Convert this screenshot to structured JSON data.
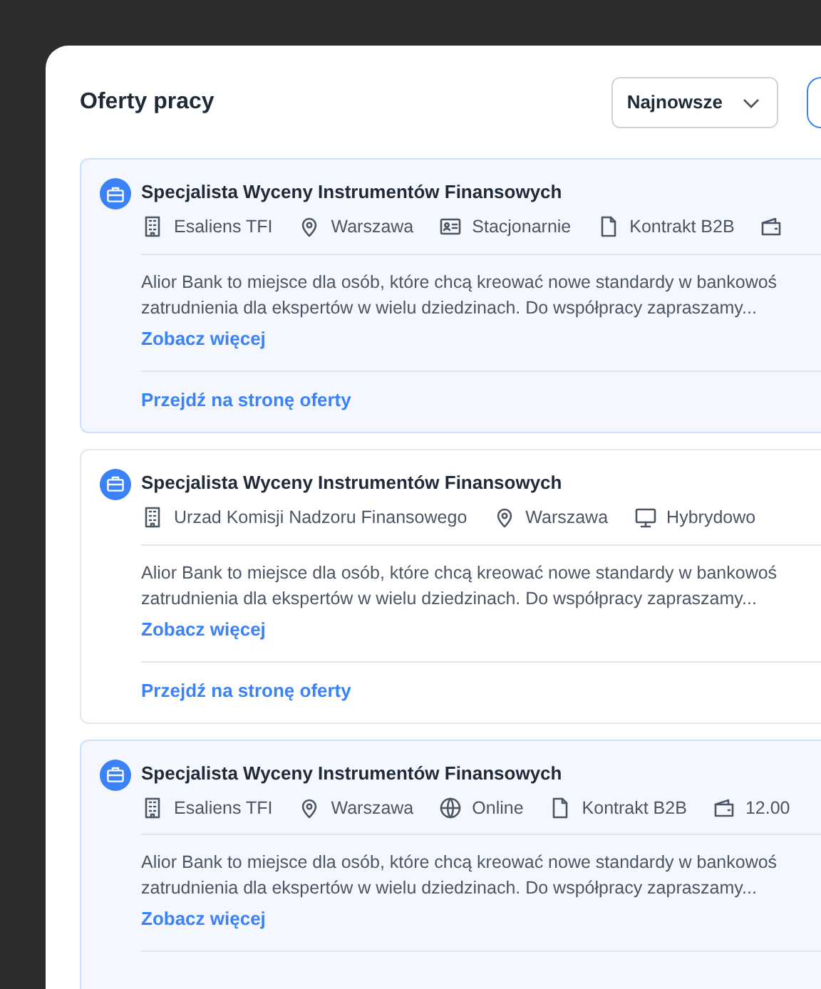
{
  "header": {
    "title": "Oferty pracy",
    "sort": "Najnowsze"
  },
  "offers": [
    {
      "highlighted": true,
      "title": "Specjalista Wyceny Instrumentów Finansowych",
      "meta": [
        {
          "kind": "company",
          "text": "Esaliens TFI"
        },
        {
          "kind": "location",
          "text": "Warszawa"
        },
        {
          "kind": "office",
          "text": "Stacjonarnie"
        },
        {
          "kind": "contract",
          "text": "Kontrakt B2B"
        },
        {
          "kind": "salary"
        }
      ],
      "description": "Alior Bank to miejsce dla osób, które chcą kreować nowe standardy w bankowoś\nzatrudnienia dla ekspertów w wielu dziedzinach. Do współpracy zapraszamy...",
      "more": "Zobacz więcej",
      "link": "Przejdź na stronę oferty"
    },
    {
      "highlighted": false,
      "title": "Specjalista Wyceny Instrumentów Finansowych",
      "meta": [
        {
          "kind": "company",
          "text": "Urzad Komisji Nadzoru Finansowego"
        },
        {
          "kind": "location",
          "text": "Warszawa"
        },
        {
          "kind": "hybrid",
          "text": "Hybrydowo"
        }
      ],
      "description": "Alior Bank to miejsce dla osób, które chcą kreować nowe standardy w bankowoś\nzatrudnienia dla ekspertów w wielu dziedzinach. Do współpracy zapraszamy...",
      "more": "Zobacz więcej",
      "link": "Przejdź na stronę oferty"
    },
    {
      "highlighted": true,
      "title": "Specjalista Wyceny Instrumentów Finansowych",
      "meta": [
        {
          "kind": "company",
          "text": "Esaliens TFI"
        },
        {
          "kind": "location",
          "text": "Warszawa"
        },
        {
          "kind": "online",
          "text": "Online"
        },
        {
          "kind": "contract",
          "text": "Kontrakt B2B"
        },
        {
          "kind": "salary",
          "text": "12.00"
        }
      ],
      "description": "Alior Bank to miejsce dla osób, które chcą kreować nowe standardy w bankowoś\nzatrudnienia dla ekspertów w wielu dziedzinach. Do współpracy zapraszamy...",
      "more": "Zobacz więcej"
    }
  ]
}
